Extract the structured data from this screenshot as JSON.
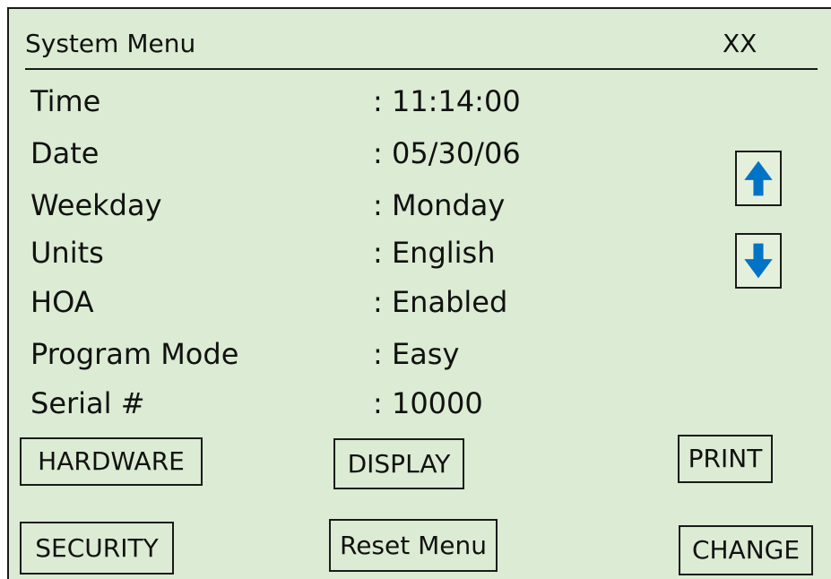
{
  "header": {
    "title": "System Menu",
    "screen_id": "XX"
  },
  "fields": [
    {
      "label": "Time",
      "value": ": 11:14:00"
    },
    {
      "label": "Date",
      "value": ": 05/30/06"
    },
    {
      "label": "Weekday",
      "value": ": Monday"
    },
    {
      "label": "Units",
      "value": ": English"
    },
    {
      "label": "HOA",
      "value": ": Enabled"
    },
    {
      "label": "Program Mode",
      "value": ": Easy"
    },
    {
      "label": "Serial #",
      "value": ": 10000"
    }
  ],
  "scroll": {
    "up_icon": "arrow-up-icon",
    "down_icon": "arrow-down-icon",
    "arrow_color": "#0073c6"
  },
  "buttons": {
    "hardware": "HARDWARE",
    "display": "DISPLAY",
    "print": "PRINT",
    "security": "SECURITY",
    "reset_menu": "Reset Menu",
    "change": "CHANGE"
  },
  "colors": {
    "screen_background": "#dcebd3",
    "text": "#111111",
    "border": "#1a1a1a"
  }
}
